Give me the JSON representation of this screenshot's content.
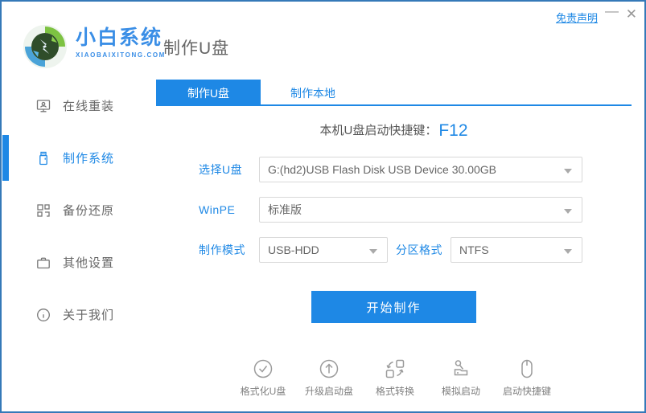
{
  "titlebar": {
    "disclaimer": "免责声明",
    "minimize_icon": "—",
    "close_icon": "✕"
  },
  "brand": {
    "name": "小白系统",
    "domain": "XIAOBAIXITONG.COM"
  },
  "header": {
    "page_title": "制作U盘"
  },
  "sidebar": {
    "items": [
      {
        "label": "在线重装",
        "icon": "monitor-user-icon",
        "active": false
      },
      {
        "label": "制作系统",
        "icon": "usb-drive-icon",
        "active": true
      },
      {
        "label": "备份还原",
        "icon": "backup-grid-icon",
        "active": false
      },
      {
        "label": "其他设置",
        "icon": "briefcase-icon",
        "active": false
      },
      {
        "label": "关于我们",
        "icon": "info-icon",
        "active": false
      }
    ]
  },
  "tabs": [
    {
      "label": "制作U盘",
      "active": true
    },
    {
      "label": "制作本地",
      "active": false
    }
  ],
  "content": {
    "hotkey_label": "本机U盘启动快捷键：",
    "hotkey_value": "F12",
    "usb_label": "选择U盘",
    "usb_value": "G:(hd2)USB Flash Disk USB Device 30.00GB",
    "winpe_label": "WinPE",
    "winpe_value": "标准版",
    "mode_label": "制作模式",
    "mode_value": "USB-HDD",
    "partition_label": "分区格式",
    "partition_value": "NTFS",
    "start_button": "开始制作"
  },
  "tools": [
    {
      "label": "格式化U盘",
      "icon": "check-circle-icon"
    },
    {
      "label": "升级启动盘",
      "icon": "arrow-up-circle-icon"
    },
    {
      "label": "格式转换",
      "icon": "convert-icon"
    },
    {
      "label": "模拟启动",
      "icon": "joystick-icon"
    },
    {
      "label": "启动快捷键",
      "icon": "mouse-icon"
    }
  ],
  "colors": {
    "accent": "#1e88e5",
    "window_border": "#3579b8",
    "text_dark": "#666666",
    "icon_gray": "#9b9b9b"
  }
}
